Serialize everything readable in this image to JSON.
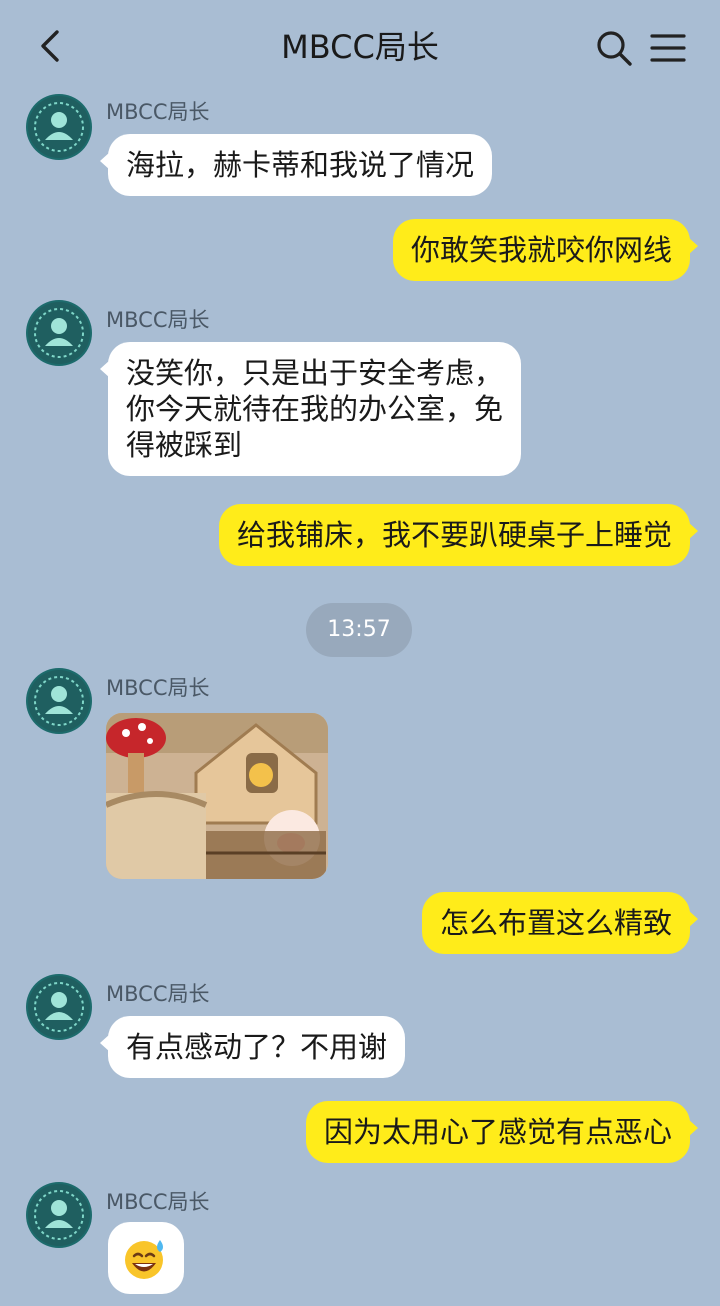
{
  "header": {
    "title": "MBCC局长",
    "back_icon": "back-arrow-icon",
    "search_icon": "search-icon",
    "menu_icon": "menu-icon"
  },
  "messages": [
    {
      "sender": "MBCC局长",
      "text": "海拉，赫卡蒂和我说了情况"
    },
    {
      "text": "你敢笑我就咬你网线"
    },
    {
      "sender": "MBCC局长",
      "lines": [
        "没笑你，只是出于安全考虑，",
        "你今天就待在我的办公室，免",
        "得被踩到"
      ]
    },
    {
      "text": "给我铺床，我不要趴硬桌子上睡觉"
    },
    {
      "sender": "MBCC局长",
      "kind": "image"
    },
    {
      "text": "怎么布置这么精致"
    },
    {
      "sender": "MBCC局长",
      "text": "有点感动了？不用谢"
    },
    {
      "text": "因为太用心了感觉有点恶心"
    },
    {
      "sender": "MBCC局长",
      "kind": "emoji",
      "emoji": "😅"
    }
  ],
  "timestamp": "13:57",
  "colors": {
    "background": "#a9bdd3",
    "incoming_bubble": "#ffffff",
    "outgoing_bubble": "#ffec1a",
    "avatar": "#1d6b6c"
  }
}
